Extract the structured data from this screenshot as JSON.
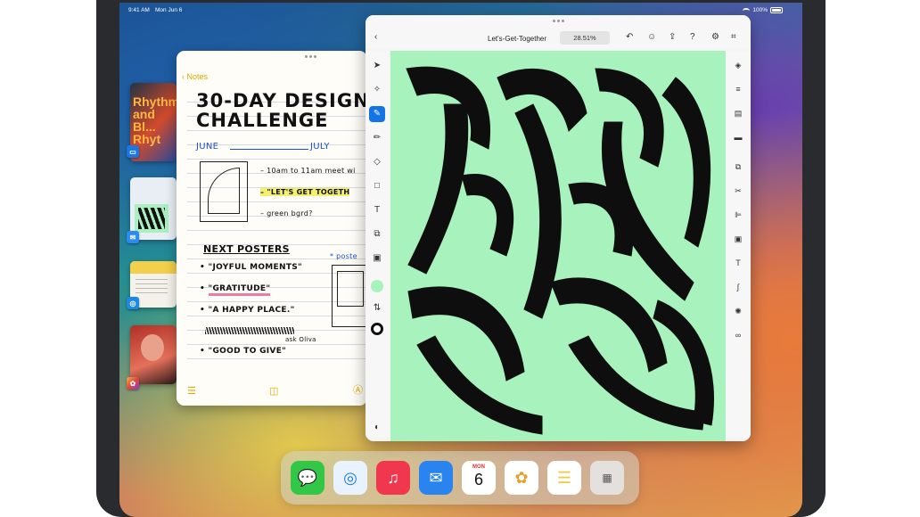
{
  "status": {
    "time": "9:41 AM",
    "date": "Mon Jun 6",
    "battery": "100%"
  },
  "thumbnails": [
    {
      "name": "keynote",
      "text": "Rhythm and Bl... Rhyt"
    },
    {
      "name": "mail"
    },
    {
      "name": "safari"
    },
    {
      "name": "photos"
    }
  ],
  "notes": {
    "back_label": "Notes",
    "title_line1": "30-DAY DESIGN",
    "title_line2": "CHALLENGE",
    "month_start": "JUNE",
    "month_end": "JULY",
    "bullet1": "– 10am to 11am meet wi",
    "bullet2": "– \"LET'S GET TOGETH",
    "bullet3": "– green bgrd?",
    "section": "NEXT POSTERS",
    "item1": "• \"JOYFUL MOMENTS\"",
    "item2": "\"GRATITUDE\"",
    "item3": "• \"A HAPPY PLACE.\"",
    "note_ask": "ask Oliva",
    "item5": "• \"GOOD TO GIVE\"",
    "post_note": "* poste"
  },
  "illustrator": {
    "document_title": "Let's-Get-Together",
    "zoom": "28.51%",
    "artwork_text": "Let's Get Together"
  },
  "dock": {
    "apps": [
      "Messages",
      "Safari",
      "Music",
      "Mail",
      "Calendar",
      "Photos",
      "Notes",
      "App Library"
    ],
    "calendar_day": "MON",
    "calendar_date": "6"
  },
  "colors": {
    "accent": "#1473e6",
    "notes_yellow": "#e0a800",
    "canvas_green": "#a7f2bd"
  }
}
